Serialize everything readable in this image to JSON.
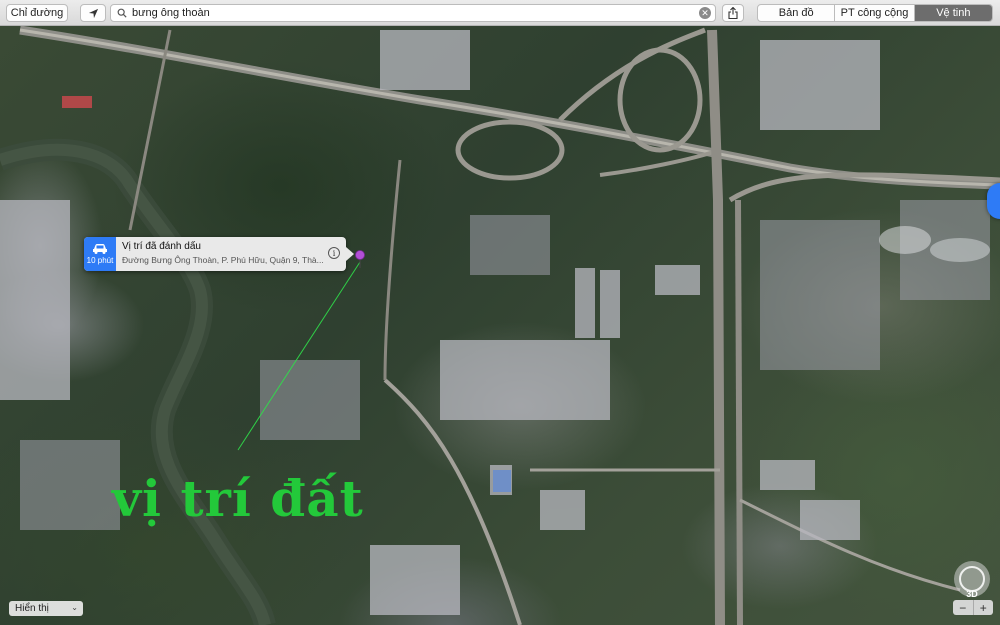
{
  "toolbar": {
    "directions_label": "Chỉ đường",
    "search_value": "bưng ông thoàn",
    "map_modes": [
      {
        "label": "Bản đồ",
        "active": false
      },
      {
        "label": "PT công cộng",
        "active": false
      },
      {
        "label": "Vệ tinh",
        "active": true
      }
    ]
  },
  "callout": {
    "eta": "10 phút",
    "title": "Vị trí đã đánh dấu",
    "address": "Đường Bưng Ông Thoàn, P. Phú Hữu, Quận 9, Thà...",
    "info_icon": "info-icon"
  },
  "annotation": {
    "text": "vị trí đất",
    "color": "#23c93a"
  },
  "controls": {
    "display_label": "Hiển thị",
    "mode_3d_label": "3D",
    "zoom_out_label": "−",
    "zoom_in_label": "+"
  },
  "colors": {
    "accent": "#2e7bf6",
    "pin": "#b24fd6",
    "active_segment": "#6d6d6d"
  }
}
